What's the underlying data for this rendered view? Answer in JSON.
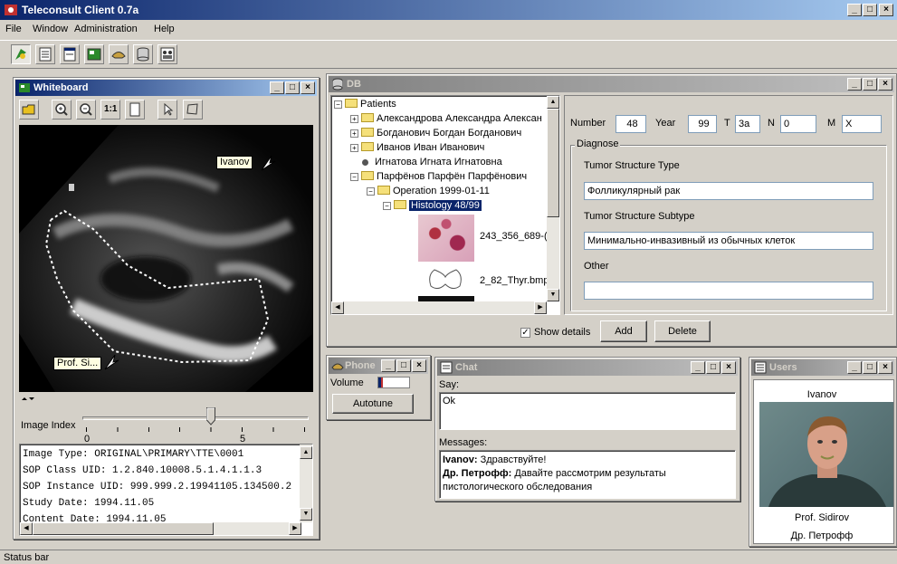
{
  "app": {
    "title": "Teleconsult Client 0.7a",
    "menu": [
      "File",
      "Window",
      "Administration",
      "Help"
    ],
    "status_bar": "Status bar"
  },
  "whiteboard": {
    "title": "Whiteboard",
    "annotation_ivanov": "Ivanov",
    "annotation_sidirov": "Prof. Si...",
    "image_index_label": "Image Index",
    "slider_ticks": [
      "0",
      "5"
    ],
    "image_index_value": 4,
    "tool_zoom_label": "1:1",
    "info_lines": [
      "Image Type: ORIGINAL\\PRIMARY\\TTE\\0001",
      "SOP Class UID: 1.2.840.10008.5.1.4.1.1.3",
      "SOP Instance UID: 999.999.2.19941105.134500.2",
      "Study Date: 1994.11.05",
      "Content Date: 1994.11.05"
    ]
  },
  "db": {
    "title": "DB",
    "tree": {
      "root": "Patients",
      "patients": [
        "Александрова Александра Алексан",
        "Богданович Богдан Богданович",
        "Иванов Иван Иванович",
        "Игнатова Игната Игнатовна",
        "Парфёнов Парфён Парфёнович"
      ],
      "operation": "Operation 1999-01-11",
      "histology": "Histology 48/99",
      "images": [
        "243_356_689-(",
        "2_82_Thyr.bmp"
      ]
    },
    "form": {
      "number_label": "Number",
      "number_value": "48",
      "year_label": "Year",
      "year_value": "99",
      "t_label": "T",
      "t_value": "3a",
      "n_label": "N",
      "n_value": "0",
      "m_label": "M",
      "m_value": "X",
      "diagnose_label": "Diagnose",
      "tumor_type_label": "Tumor Structure Type",
      "tumor_type_value": "Фолликулярный рак",
      "tumor_subtype_label": "Tumor Structure Subtype",
      "tumor_subtype_value": "Минимально-инвазивный из обычных клеток",
      "other_label": "Other",
      "other_value": ""
    },
    "show_details_label": "Show details",
    "show_details_checked": true,
    "add_label": "Add",
    "delete_label": "Delete"
  },
  "phone": {
    "title": "Phone",
    "volume_label": "Volume",
    "volume_level": 0.15,
    "autotune_label": "Autotune"
  },
  "chat": {
    "title": "Chat",
    "say_label": "Say:",
    "say_value": "Ok",
    "messages_label": "Messages:",
    "messages": [
      {
        "from": "Ivanov:",
        "text": " Здравствуйте!"
      },
      {
        "from": "Др. Петрофф:",
        "text": " Давайте рассмотрим результаты пистологического обследования"
      }
    ]
  },
  "users": {
    "title": "Users",
    "top_user": "Ivanov",
    "bottom_user_1": "Prof. Sidirov",
    "bottom_user_2": "Др. Петрофф"
  },
  "colors": {
    "titlebar_active": "#0a246a",
    "selection": "#0a246a",
    "annotation_bg": "#ffffe1",
    "background": "#d4d0c8"
  }
}
